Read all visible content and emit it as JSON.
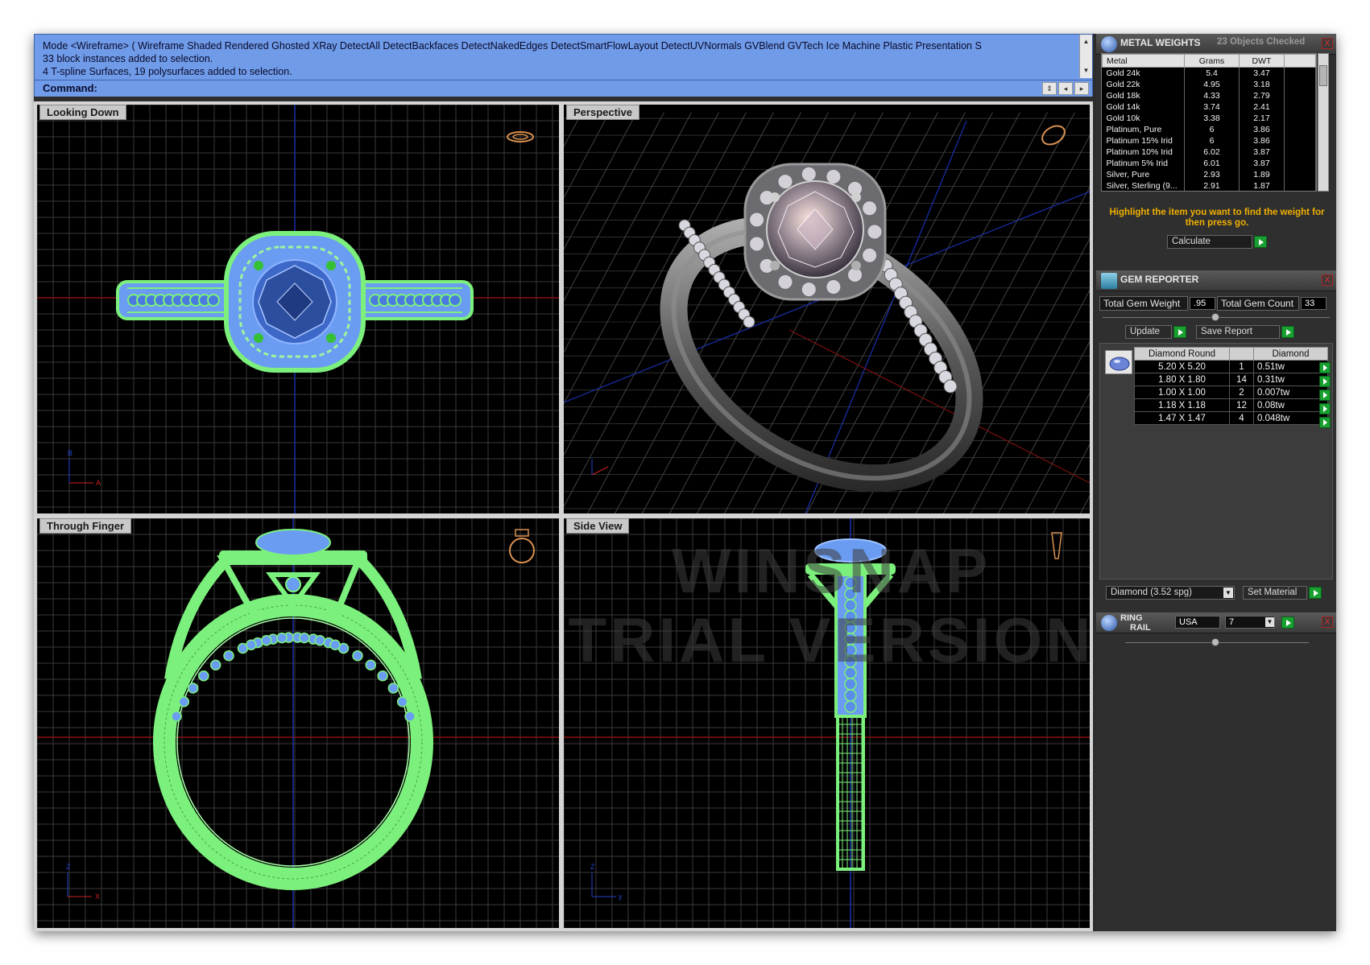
{
  "command": {
    "history": [
      "Mode <Wireframe> ( Wireframe  Shaded  Rendered  Ghosted  XRay  DetectAll  DetectBackfaces  DetectNakedEdges  DetectSmartFlowLayout  DetectUVNormals  GVBlend  GVTech  Ice  Machine  Plastic  Presentation  S",
      "33 block instances added to selection.",
      "4 T-spline Surfaces, 19 polysurfaces added to selection."
    ],
    "prompt": "Command:"
  },
  "viewports": {
    "top_left": "Looking Down",
    "top_right": "Perspective",
    "bottom_left": "Through Finger",
    "bottom_right": "Side View"
  },
  "axis_labels": {
    "looking_down": {
      "v": "B",
      "h": "A"
    },
    "through_finger": {
      "v": "Z",
      "h": "X"
    },
    "side_view": {
      "v": "Z",
      "h": "y"
    }
  },
  "watermark": {
    "line1": "WINSNAP",
    "line2": "TRIAL VERSION"
  },
  "metal_weights": {
    "title": "METAL WEIGHTS",
    "status": "23 Objects Checked",
    "close": "X",
    "columns": [
      "Metal",
      "Grams",
      "DWT"
    ],
    "rows": [
      [
        "Gold 24k",
        "5.4",
        "3.47"
      ],
      [
        "Gold 22k",
        "4.95",
        "3.18"
      ],
      [
        "Gold 18k",
        "4.33",
        "2.79"
      ],
      [
        "Gold 14k",
        "3.74",
        "2.41"
      ],
      [
        "Gold 10k",
        "3.38",
        "2.17"
      ],
      [
        "Platinum, Pure",
        "6",
        "3.86"
      ],
      [
        "Platinum 15% Irid",
        "6",
        "3.86"
      ],
      [
        "Platinum 10% Irid",
        "6.02",
        "3.87"
      ],
      [
        "Platinum 5% Irid",
        "6.01",
        "3.87"
      ],
      [
        "Silver, Pure",
        "2.93",
        "1.89"
      ],
      [
        "Silver, Sterling (9...",
        "2.91",
        "1.87"
      ]
    ],
    "note": "Highlight the item you want to find the weight for then press go.",
    "calculate": "Calculate"
  },
  "gem_reporter": {
    "title": "GEM REPORTER",
    "close": "X",
    "total_weight_label": "Total Gem Weight",
    "total_weight_value": ".95",
    "total_count_label": "Total Gem Count",
    "total_count_value": "33",
    "update": "Update",
    "save_report": "Save Report",
    "columns": [
      "Diamond Round",
      "",
      "Diamond"
    ],
    "rows": [
      [
        "5.20 X 5.20",
        "1",
        "0.51tw"
      ],
      [
        "1.80 X 1.80",
        "14",
        "0.31tw"
      ],
      [
        "1.00 X 1.00",
        "2",
        "0.007tw"
      ],
      [
        "1.18 X 1.18",
        "12",
        "0.08tw"
      ],
      [
        "1.47 X 1.47",
        "4",
        "0.048tw"
      ]
    ],
    "material": "Diamond    (3.52 spg)",
    "set_material": "Set Material"
  },
  "ring_rail": {
    "title_line1": "RING",
    "title_line2": "RAIL",
    "country": "USA",
    "size": "7",
    "close": "X"
  },
  "colors": {
    "command_bg": "#6f9be8",
    "wire_green": "#7cf07c",
    "gem_blue": "#7fa8f0",
    "warn_text": "#f0b000",
    "go_green": "#18a030"
  }
}
